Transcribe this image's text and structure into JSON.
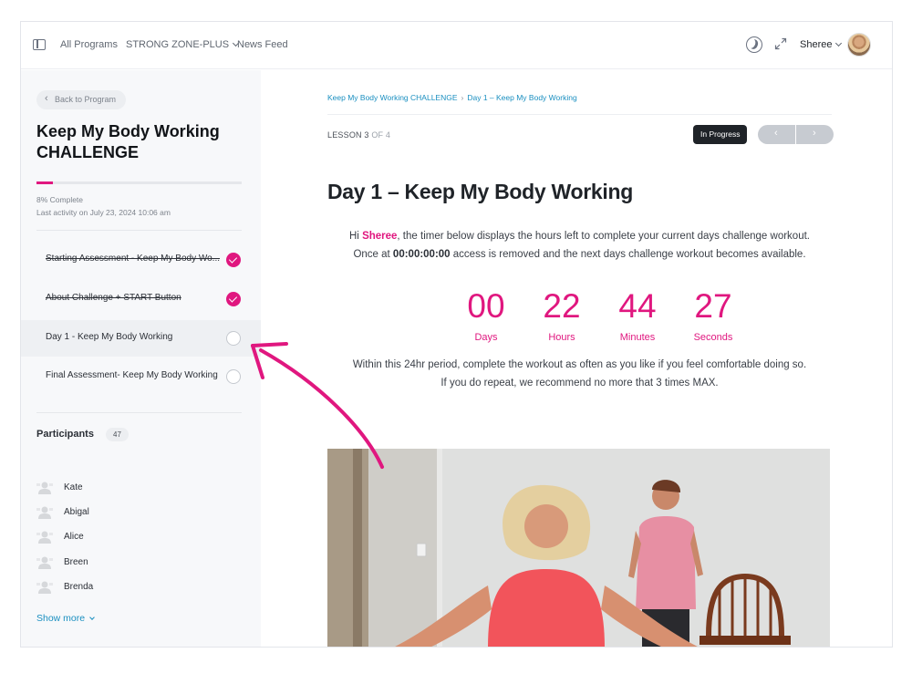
{
  "topnav": {
    "links": [
      "All Programs",
      "STRONG ZONE-PLUS",
      "News Feed"
    ],
    "user_name": "Sheree"
  },
  "sidebar": {
    "back_label": "Back to Program",
    "course_title": "Keep My Body Working CHALLENGE",
    "progress_percent": 8,
    "progress_text": "8% Complete",
    "last_activity": "Last activity on July 23, 2024 10:06 am",
    "lessons": [
      {
        "label": "Starting Assessment - Keep My Body Wo...",
        "status": "done"
      },
      {
        "label": "About Challenge + START Button",
        "status": "done"
      },
      {
        "label": "Day 1 - Keep My Body Working",
        "status": "current"
      },
      {
        "label": "Final Assessment- Keep My Body Working",
        "status": "open"
      }
    ],
    "participants_title": "Participants",
    "participants_count": "47",
    "participants": [
      "Kate",
      "Abigal",
      "Alice",
      "Breen",
      "Brenda"
    ],
    "show_more": "Show more"
  },
  "main": {
    "breadcrumb": [
      "Keep My Body Working CHALLENGE",
      "Day 1 – Keep My Body Working"
    ],
    "lesson_counter": "LESSON 3",
    "lesson_counter_total": "OF 4",
    "status": "In Progress",
    "heading": "Day 1 – Keep My Body Working",
    "intro": {
      "hi": "Hi ",
      "name": "Sheree",
      "line1_rest": ", the timer below displays the hours left to complete your current days challenge workout.",
      "line2_pre": "Once at ",
      "zero_time": "00:00:00:00",
      "line2_post": " access is removed and the next days challenge workout becomes available."
    },
    "countdown": [
      {
        "value": "00",
        "label": "Days"
      },
      {
        "value": "22",
        "label": "Hours"
      },
      {
        "value": "44",
        "label": "Minutes"
      },
      {
        "value": "27",
        "label": "Seconds"
      }
    ],
    "outro_line1": "Within this 24hr period, complete the workout as often as you like if you feel comfortable doing so.",
    "outro_line2": "If you do repeat, we recommend no more that 3 times MAX."
  },
  "colors": {
    "accent": "#e0177f",
    "link": "#1a8fc0",
    "dark": "#1f2328"
  }
}
